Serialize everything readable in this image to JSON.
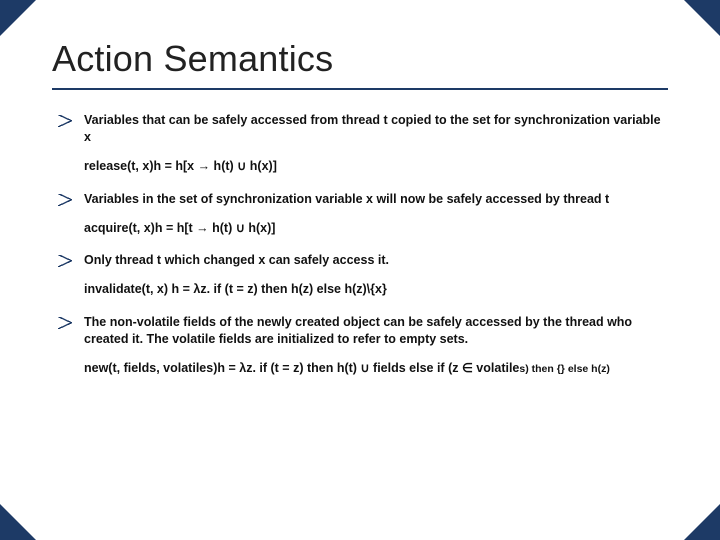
{
  "slide": {
    "title": "Action Semantics",
    "items": [
      {
        "bullet": true,
        "text": "Variables that can be safely accessed from thread t copied to the set for synchronization variable x"
      },
      {
        "bullet": false,
        "text": "release(t, x)h = h[x → h(t) ∪ h(x)]"
      },
      {
        "bullet": true,
        "text": "Variables in the set of synchronization variable x will now be safely accessed by thread t"
      },
      {
        "bullet": false,
        "text": "acquire(t, x)h = h[t → h(t) ∪ h(x)]"
      },
      {
        "bullet": true,
        "text": "Only thread t which changed x can safely access it."
      },
      {
        "bullet": false,
        "text": "invalidate(t, x) h = λz. if (t = z) then h(z) else h(z)\\{x}"
      },
      {
        "bullet": true,
        "text": "The non-volatile fields of the newly created object can be safely accessed by the thread who created it. The volatile fields are initialized to refer to empty sets."
      },
      {
        "bullet": false,
        "text": "new(t, fields, volatiles)h = λz. if (t = z) then h(t) ∪ fields else if (z ∈ volatiles) then {} else h(z)",
        "trailingSmall": true,
        "smallText": "s) then {} else h(z)"
      }
    ]
  }
}
